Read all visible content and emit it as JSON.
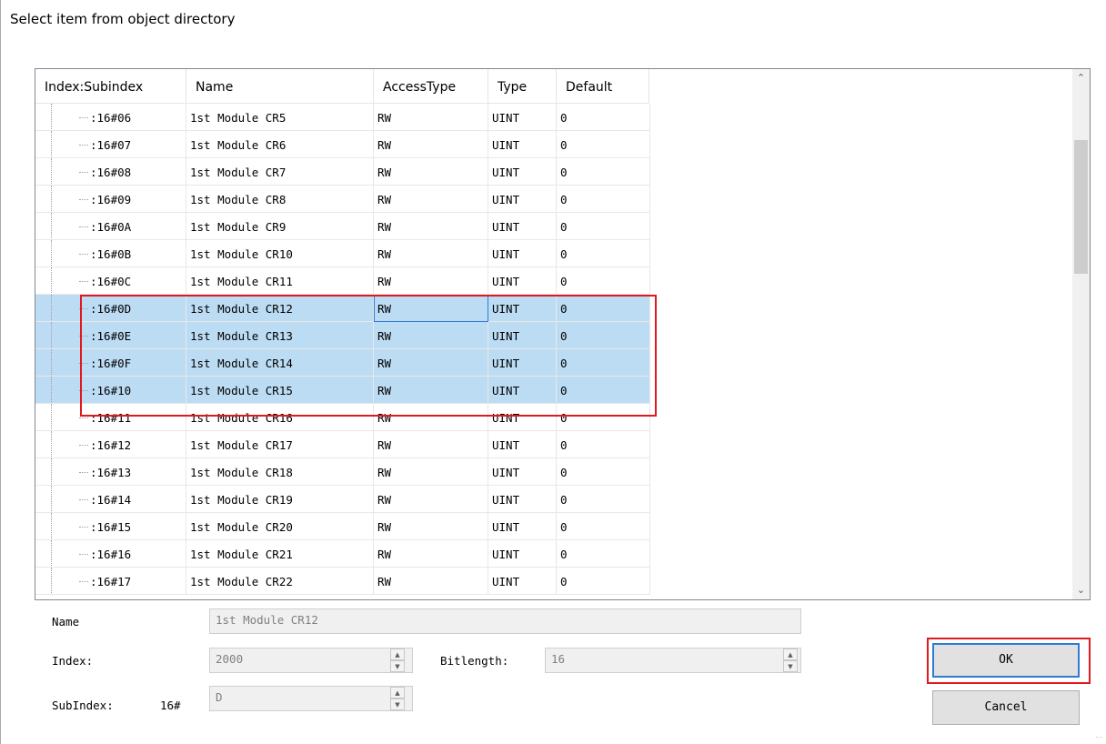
{
  "window": {
    "title": "Select item from object directory"
  },
  "table": {
    "columns": [
      "Index:Subindex",
      "Name",
      "AccessType",
      "Type",
      "Default"
    ],
    "rows": [
      {
        "index": ":16#06",
        "name": "1st Module CR5",
        "access": "RW",
        "type": "UINT",
        "default": "0",
        "selected": false
      },
      {
        "index": ":16#07",
        "name": "1st Module CR6",
        "access": "RW",
        "type": "UINT",
        "default": "0",
        "selected": false
      },
      {
        "index": ":16#08",
        "name": "1st Module CR7",
        "access": "RW",
        "type": "UINT",
        "default": "0",
        "selected": false
      },
      {
        "index": ":16#09",
        "name": "1st Module CR8",
        "access": "RW",
        "type": "UINT",
        "default": "0",
        "selected": false
      },
      {
        "index": ":16#0A",
        "name": "1st Module CR9",
        "access": "RW",
        "type": "UINT",
        "default": "0",
        "selected": false
      },
      {
        "index": ":16#0B",
        "name": "1st Module CR10",
        "access": "RW",
        "type": "UINT",
        "default": "0",
        "selected": false
      },
      {
        "index": ":16#0C",
        "name": "1st Module CR11",
        "access": "RW",
        "type": "UINT",
        "default": "0",
        "selected": false
      },
      {
        "index": ":16#0D",
        "name": "1st Module CR12",
        "access": "RW",
        "type": "UINT",
        "default": "0",
        "selected": true
      },
      {
        "index": ":16#0E",
        "name": "1st Module CR13",
        "access": "RW",
        "type": "UINT",
        "default": "0",
        "selected": true
      },
      {
        "index": ":16#0F",
        "name": "1st Module CR14",
        "access": "RW",
        "type": "UINT",
        "default": "0",
        "selected": true
      },
      {
        "index": ":16#10",
        "name": "1st Module CR15",
        "access": "RW",
        "type": "UINT",
        "default": "0",
        "selected": true
      },
      {
        "index": ":16#11",
        "name": "1st Module CR16",
        "access": "RW",
        "type": "UINT",
        "default": "0",
        "selected": false
      },
      {
        "index": ":16#12",
        "name": "1st Module CR17",
        "access": "RW",
        "type": "UINT",
        "default": "0",
        "selected": false
      },
      {
        "index": ":16#13",
        "name": "1st Module CR18",
        "access": "RW",
        "type": "UINT",
        "default": "0",
        "selected": false
      },
      {
        "index": ":16#14",
        "name": "1st Module CR19",
        "access": "RW",
        "type": "UINT",
        "default": "0",
        "selected": false
      },
      {
        "index": ":16#15",
        "name": "1st Module CR20",
        "access": "RW",
        "type": "UINT",
        "default": "0",
        "selected": false
      },
      {
        "index": ":16#16",
        "name": "1st Module CR21",
        "access": "RW",
        "type": "UINT",
        "default": "0",
        "selected": false
      },
      {
        "index": ":16#17",
        "name": "1st Module CR22",
        "access": "RW",
        "type": "UINT",
        "default": "0",
        "selected": false
      }
    ]
  },
  "details": {
    "name_label": "Name",
    "name_value": "1st Module CR12",
    "index_label": "Index:",
    "index_value": "2000",
    "bitlength_label": "Bitlength:",
    "bitlength_value": "16",
    "subindex_label": "SubIndex:",
    "subindex_prefix": "16#",
    "subindex_value": "D"
  },
  "buttons": {
    "ok": "OK",
    "cancel": "Cancel"
  },
  "icons": {
    "scroll_up": "chevron-up-icon",
    "scroll_down": "chevron-down-icon",
    "spin": "spin-arrows-icon"
  },
  "colors": {
    "selection": "#bcdcf4",
    "highlight": "#e0191f",
    "focus": "#2f7bd6"
  }
}
